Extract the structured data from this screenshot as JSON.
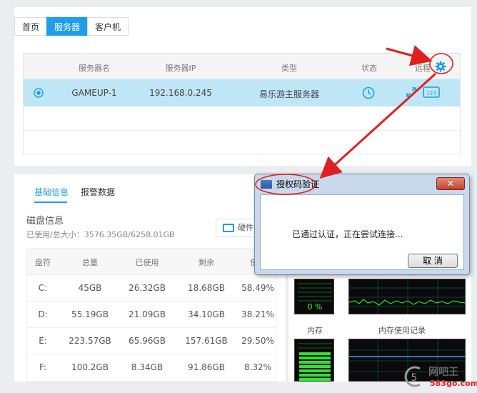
{
  "nav": {
    "tabs": [
      {
        "label": "首页"
      },
      {
        "label": "服务器"
      },
      {
        "label": "客户机"
      }
    ],
    "active_tab": "服务器"
  },
  "server_table": {
    "headers": [
      "服务器名",
      "服务器IP",
      "类型",
      "状态",
      "远程"
    ],
    "rows": [
      {
        "name": "GAMEUP-1",
        "ip": "192.168.0.245",
        "type": "易乐游主服务器",
        "status_icon": "clock-icon",
        "remote_icons": [
          "expand-icon",
          "keyboard-123-icon"
        ]
      }
    ],
    "settings_icon": "gear-icon"
  },
  "info_panel": {
    "tabs": [
      {
        "label": "基础信息"
      },
      {
        "label": "报警数据"
      }
    ],
    "active_tab": "基础信息",
    "disk_title": "磁盘信息",
    "disk_usage": "已使用/总大小：3576.35GB/6258.01GB",
    "hardware_button": "硬件",
    "disk_table": {
      "headers": [
        "盘符",
        "总量",
        "已使用",
        "剩余",
        "使用"
      ],
      "rows": [
        {
          "drive": "C:",
          "total": "45GB",
          "used": "26.32GB",
          "free": "18.68GB",
          "pct": "58.49%"
        },
        {
          "drive": "D:",
          "total": "55.19GB",
          "used": "21.09GB",
          "free": "34.10GB",
          "pct": "38.21%"
        },
        {
          "drive": "E:",
          "total": "223.57GB",
          "used": "65.96GB",
          "free": "157.61GB",
          "pct": "29.50%"
        },
        {
          "drive": "F:",
          "total": "100.2GB",
          "used": "8.34GB",
          "free": "91.86GB",
          "pct": "8.32%"
        }
      ]
    }
  },
  "monitor": {
    "cpu_percent": "0 %",
    "memory_label": "内存",
    "memory_history_label": "内存使用记录"
  },
  "dialog": {
    "title": "授权码验证",
    "close": "✕",
    "message": "已通过认证，正在尝试连接...",
    "cancel": "取 消"
  },
  "watermark": {
    "name": "网吧王",
    "url": "583go.com"
  },
  "colors": {
    "accent": "#1e9ee6",
    "selected_row": "#bfe6f7",
    "annotation": "#e02020"
  }
}
